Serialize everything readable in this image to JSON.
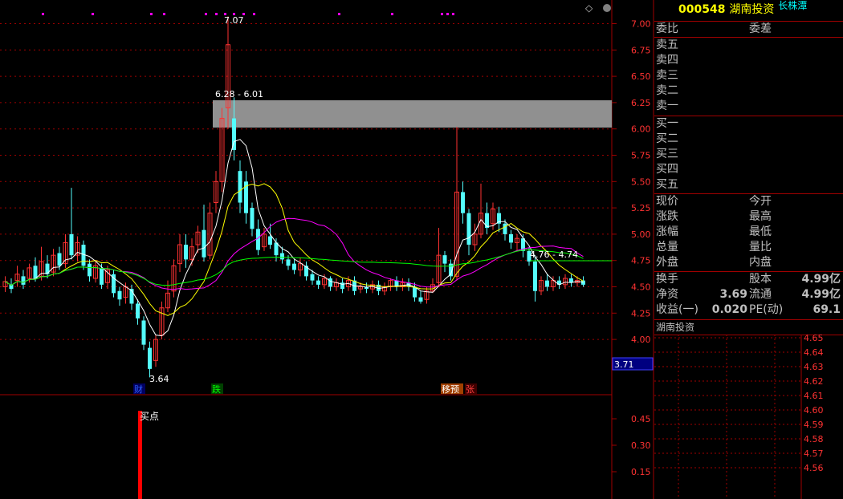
{
  "stock": {
    "code": "000548",
    "name": "湖南投资",
    "tag": "长株潭"
  },
  "top_icons": {
    "diamond": "◇",
    "circle": "●"
  },
  "price_axis": [
    "7.00",
    "6.75",
    "6.50",
    "6.25",
    "6.00",
    "5.75",
    "5.50",
    "5.25",
    "5.00",
    "4.75",
    "4.50",
    "4.25",
    "4.00"
  ],
  "current_price_box": "3.71",
  "annotations": {
    "high": "7.07",
    "low": "3.64",
    "gap": "6.28 - 6.01",
    "gap2": "4.76 - 4.74",
    "buy_point": "买点"
  },
  "event_tags": [
    {
      "text": "财",
      "color": "#3060ff",
      "bg": "#000060"
    },
    {
      "text": "跌",
      "color": "#00ff00",
      "bg": "#004000"
    },
    {
      "text": "移预",
      "color": "#ffffff",
      "bg": "#a04000"
    },
    {
      "text": "张",
      "color": "#ff4040",
      "bg": "#400000"
    }
  ],
  "indicator_axis": [
    "0.45",
    "0.30",
    "0.15"
  ],
  "order_book": {
    "weibi_label": "委比",
    "weicha_label": "委差",
    "sell": [
      "卖五",
      "卖四",
      "卖三",
      "卖二",
      "卖一"
    ],
    "buy": [
      "买一",
      "买二",
      "买三",
      "买四",
      "买五"
    ]
  },
  "quote": [
    {
      "l1": "现价",
      "v1": "",
      "l2": "今开",
      "v2": ""
    },
    {
      "l1": "涨跌",
      "v1": "",
      "l2": "最高",
      "v2": ""
    },
    {
      "l1": "涨幅",
      "v1": "",
      "l2": "最低",
      "v2": ""
    },
    {
      "l1": "总量",
      "v1": "",
      "l2": "量比",
      "v2": ""
    },
    {
      "l1": "外盘",
      "v1": "",
      "l2": "内盘",
      "v2": ""
    }
  ],
  "fundamentals": [
    {
      "l1": "换手",
      "v1": "",
      "l2": "股本",
      "v2": "4.99亿"
    },
    {
      "l1": "净资",
      "v1": "3.69",
      "l2": "流通",
      "v2": "4.99亿"
    },
    {
      "l1": "收益(一)",
      "v1": "0.020",
      "l2": "PE(动)",
      "v2": "69.1"
    }
  ],
  "mini_chart": {
    "title": "湖南投资",
    "axis": [
      "4.65",
      "4.64",
      "4.63",
      "4.62",
      "4.61",
      "4.60",
      "4.59",
      "4.58",
      "4.57",
      "4.56"
    ]
  },
  "colors": {
    "up": "#ff3232",
    "down": "#54fcfc",
    "grid": "#a00000",
    "ma5": "#ffffff",
    "ma10": "#ffff00",
    "ma20": "#ff00ff",
    "ma60": "#00ff00"
  }
}
